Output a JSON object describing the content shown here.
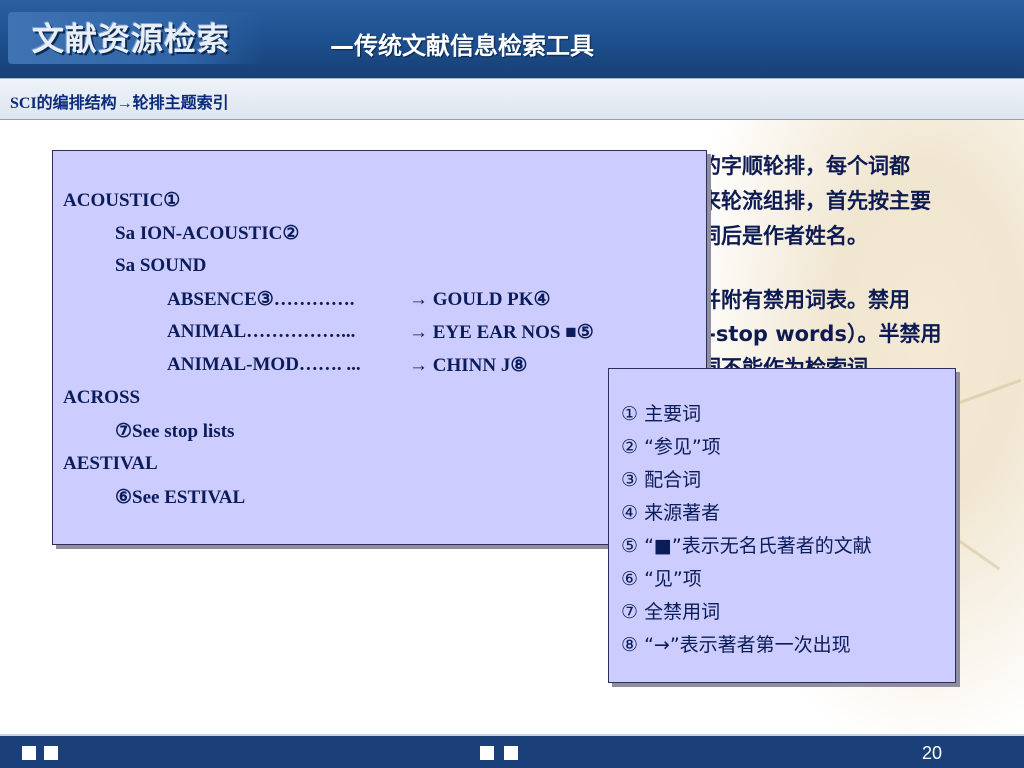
{
  "header": {
    "logo_text": "文献资源检索",
    "subtitle": "—传统文献信息检索工具"
  },
  "section_title": "SCI的编排结构→轮排主题索引",
  "background_text": [
    "的字顺轮排，每个词都",
    "来轮流组排，首先按主要",
    "词后是作者姓名。",
    " 并附有禁用词表。禁用",
    "l-stop words）。半禁用",
    "词不能作为检索词"
  ],
  "index_example": {
    "lines": [
      {
        "text": "ACOUSTIC①",
        "indent": 0
      },
      {
        "text": "Sa ION-ACOUSTIC②",
        "indent": 1
      },
      {
        "text": "Sa SOUND",
        "indent": 1
      },
      {
        "text": "ABSENCE③………….",
        "indent": 2,
        "author": "→ GOULD PK④"
      },
      {
        "text": "ANIMAL……………...",
        "indent": 2,
        "author": "→ EYE EAR NOS ■⑤"
      },
      {
        "text": "ANIMAL-MOD……. ...",
        "indent": 2,
        "author": "→ CHINN J⑧"
      },
      {
        "text": "ACROSS",
        "indent": 0
      },
      {
        "text": "⑦See stop lists",
        "indent": 1
      },
      {
        "text": "AESTIVAL",
        "indent": 0
      },
      {
        "text": "⑥See ESTIVAL",
        "indent": 1
      }
    ]
  },
  "legend": [
    "① 主要词",
    "② “参见”项",
    "③ 配合词",
    "④ 来源著者",
    "⑤ “■”表示无名氏著者的文献",
    "⑥ “见”项",
    "⑦ 全禁用词",
    "⑧ “→”表示著者第一次出现"
  ],
  "footer": {
    "page_number": "20"
  },
  "colors": {
    "header_blue": "#1d4f8d",
    "box_fill": "#ccccff",
    "text_navy": "#0b1c5a",
    "footer_blue": "#1b3f78"
  }
}
